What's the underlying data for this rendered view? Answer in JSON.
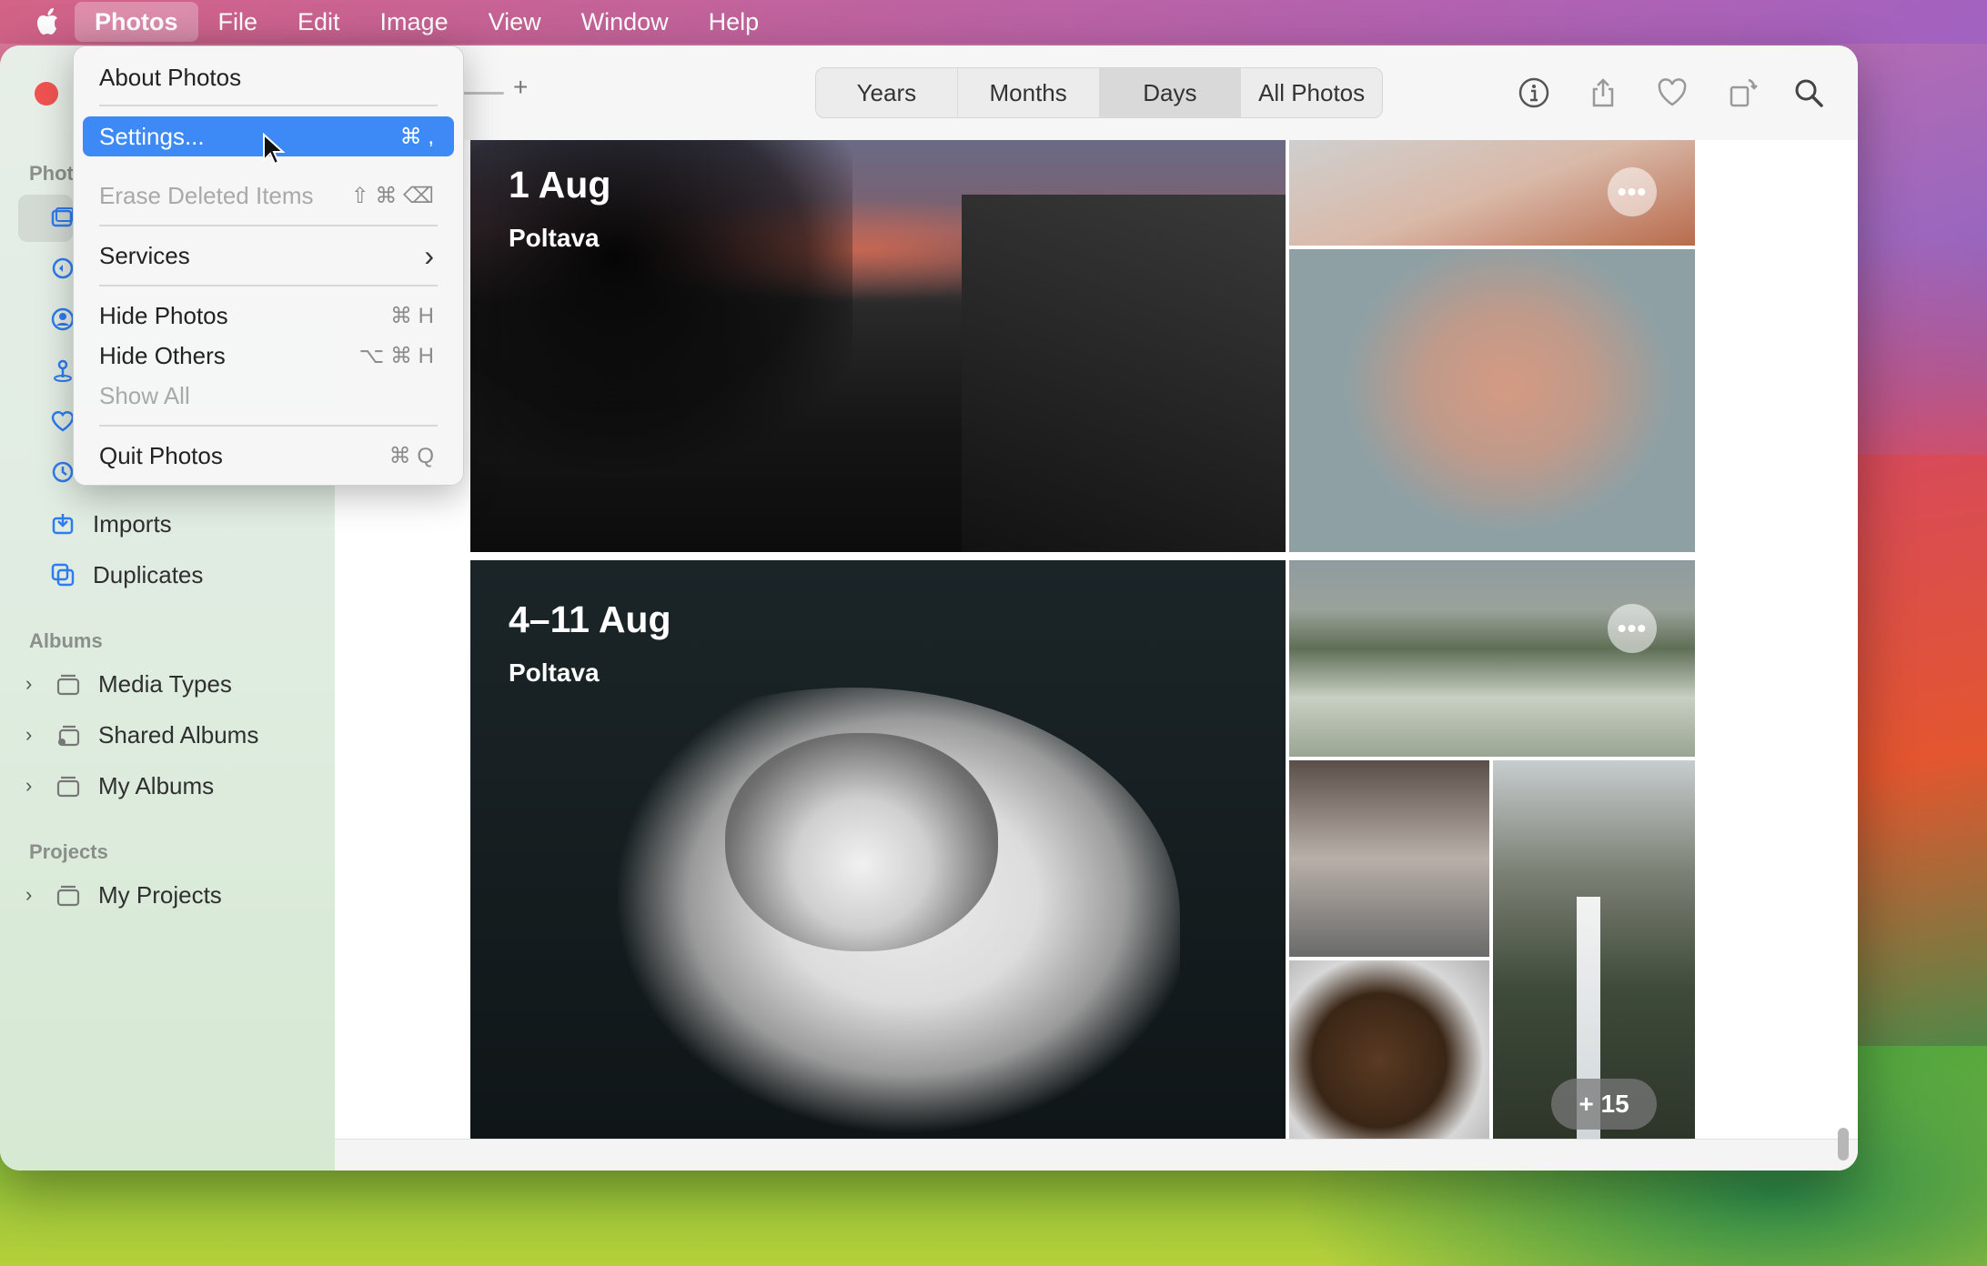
{
  "menubar": {
    "items": [
      "Photos",
      "File",
      "Edit",
      "Image",
      "View",
      "Window",
      "Help"
    ],
    "active": "Photos"
  },
  "photos_menu": {
    "about": "About Photos",
    "settings": {
      "label": "Settings...",
      "shortcut": "⌘ ,"
    },
    "erase": {
      "label": "Erase Deleted Items",
      "shortcut": "⇧ ⌘ ⌫"
    },
    "services": {
      "label": "Services",
      "shortcut": "›"
    },
    "hide": {
      "label": "Hide Photos",
      "shortcut": "⌘ H"
    },
    "hide_others": {
      "label": "Hide Others",
      "shortcut": "⌥ ⌘ H"
    },
    "show_all": {
      "label": "Show All"
    },
    "quit": {
      "label": "Quit Photos",
      "shortcut": "⌘ Q"
    }
  },
  "sidebar": {
    "photos_section": "Phot",
    "imports": "Imports",
    "duplicates": "Duplicates",
    "albums_section": "Albums",
    "albums": [
      "Media Types",
      "Shared Albums",
      "My Albums"
    ],
    "projects_section": "Projects",
    "projects": [
      "My Projects"
    ]
  },
  "toolbar": {
    "zoom_plus": "+",
    "segments": [
      "Years",
      "Months",
      "Days",
      "All Photos"
    ],
    "selected_segment": "Days"
  },
  "days": [
    {
      "title": "1 Aug",
      "location": "Poltava"
    },
    {
      "title": "4–11 Aug",
      "location": "Poltava"
    }
  ],
  "more_count": "+ 15",
  "more_glyph": "•••",
  "colors": {
    "accent": "#3d8af7",
    "close": "#ef5250"
  }
}
